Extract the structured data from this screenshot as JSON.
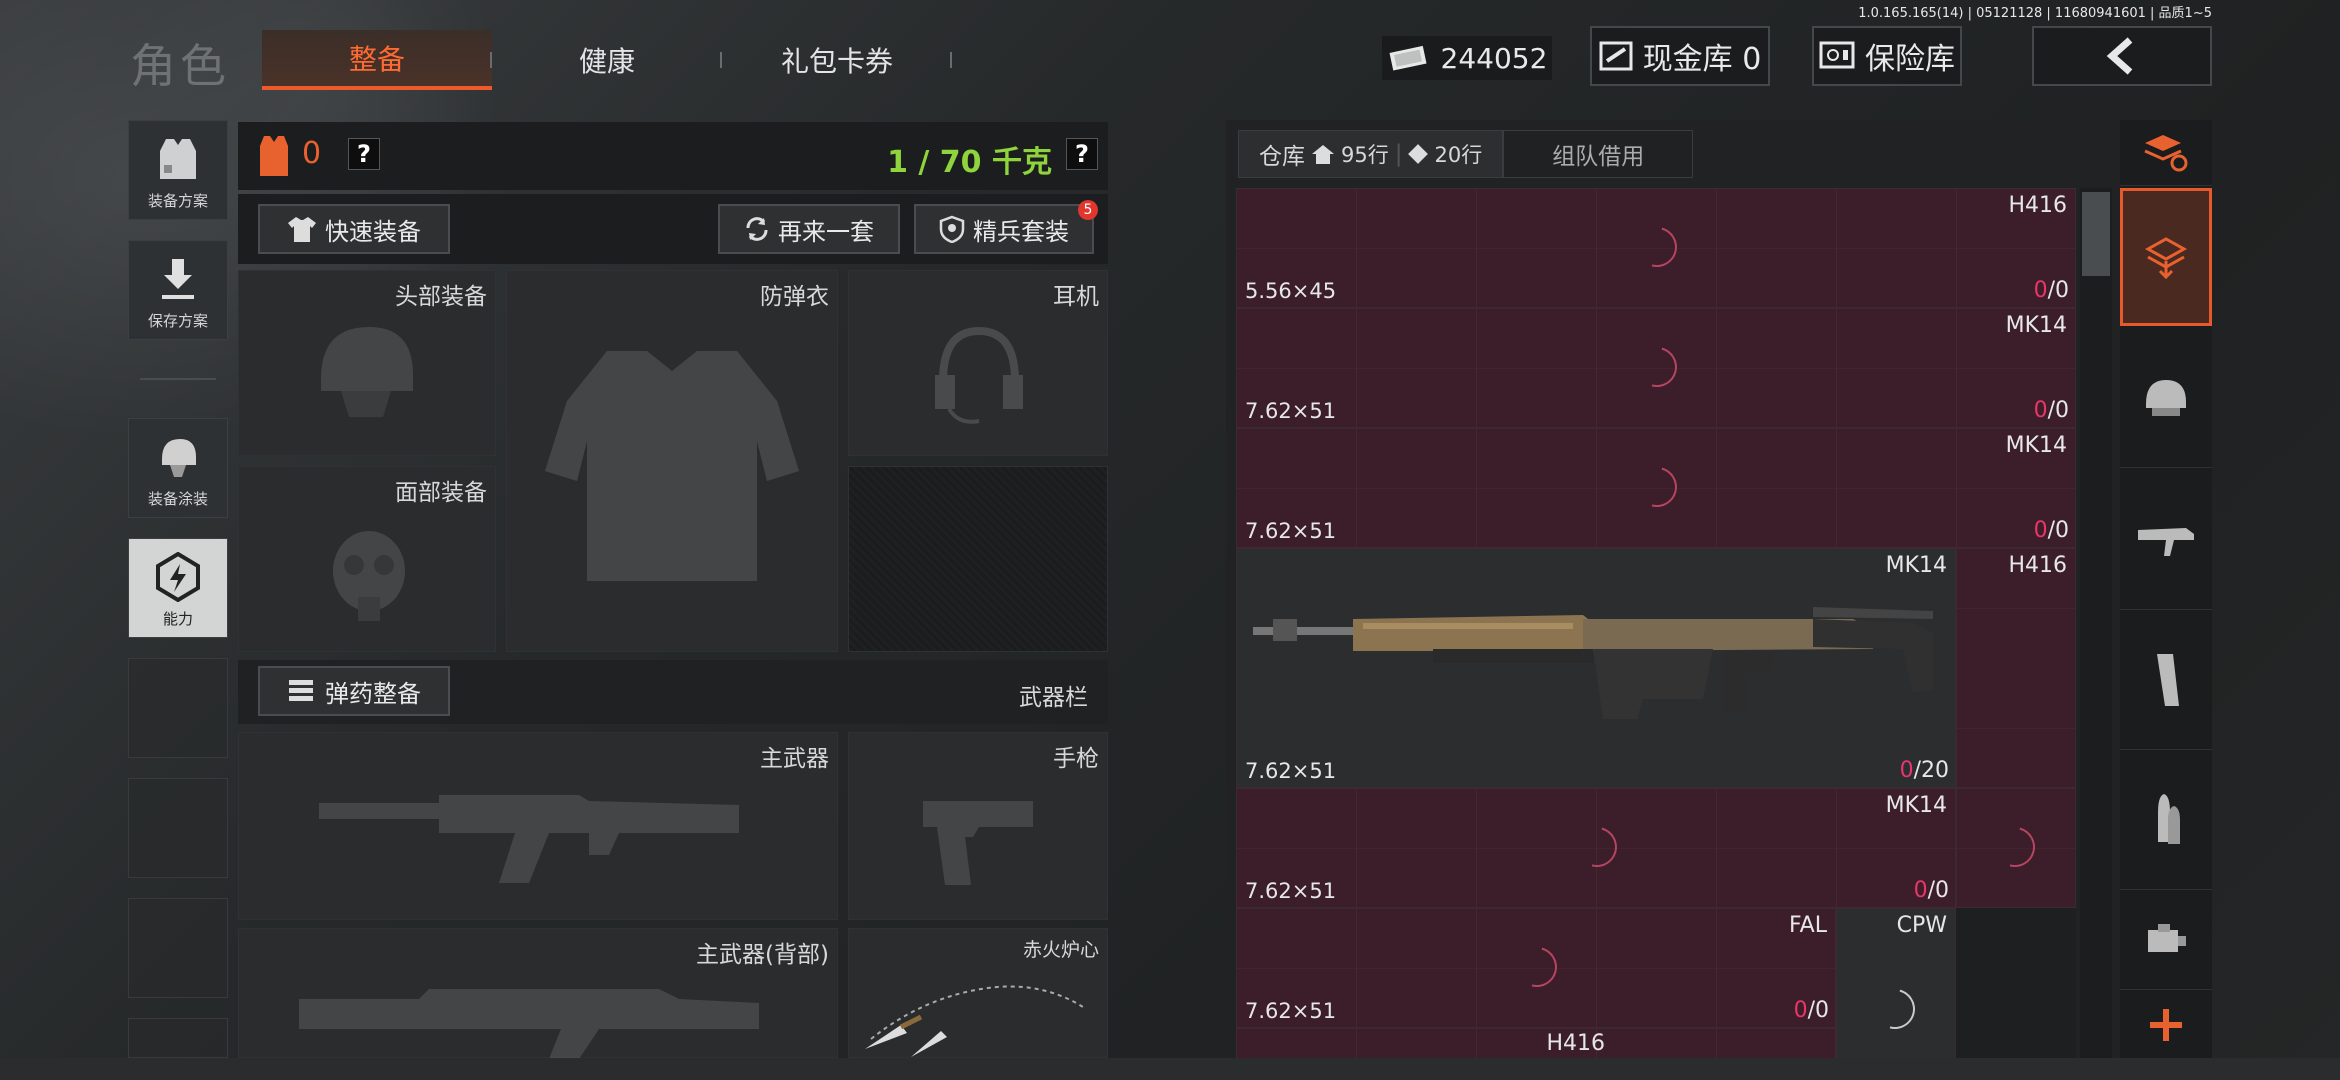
{
  "version": "1.0.165.165(14) | 05121128 | 11680941601 | 品质1~5",
  "page_title": "角色",
  "tabs": [
    {
      "label": "整备",
      "active": true
    },
    {
      "label": "健康"
    },
    {
      "label": "礼包卡券"
    }
  ],
  "money": "244052",
  "cash_store": "现金库 0",
  "safe": "保险库",
  "sidebar": [
    {
      "label": "装备方案"
    },
    {
      "label": "保存方案"
    },
    {
      "label": "装备涂装"
    },
    {
      "label": "能力"
    }
  ],
  "header": {
    "armor_count": "0",
    "weight": "1 / 70 千克"
  },
  "buttons": {
    "quick": "快速装备",
    "again": "再来一套",
    "elite": "精兵套装",
    "elite_badge": "5",
    "ammo": "弹药整备",
    "weapons_bar": "武器栏"
  },
  "slots": {
    "head": "头部装备",
    "vest": "防弹衣",
    "headset": "耳机",
    "face": "面部装备",
    "primary": "主武器",
    "pistol": "手枪",
    "primary_back": "主武器(背部)",
    "melee": "赤火炉心"
  },
  "warehouse": {
    "tab1": "仓库",
    "rows1": "95行",
    "rows2": "20行",
    "tab2": "组队借用",
    "items": [
      {
        "name": "H416",
        "cal": "5.56×45",
        "cnt0": "0",
        "cnt1": "0"
      },
      {
        "name": "MK14",
        "cal": "7.62×51",
        "cnt0": "0",
        "cnt1": "0"
      },
      {
        "name": "MK14",
        "cal": "7.62×51",
        "cnt0": "0",
        "cnt1": "0"
      },
      {
        "name": "MK14",
        "cal": "7.62×51",
        "cnt0": "0",
        "cnt1": "20"
      },
      {
        "name": "H416"
      },
      {
        "name": "MK14",
        "cal": "7.62×51",
        "cnt0": "0",
        "cnt1": "0"
      },
      {
        "name": "FAL",
        "cal": "7.62×51",
        "cnt0": "0",
        "cnt1": "0"
      },
      {
        "name": "CPW"
      },
      {
        "name": "H416"
      }
    ]
  },
  "icons": {
    "money": "cash-icon",
    "add": "plus-icon"
  }
}
